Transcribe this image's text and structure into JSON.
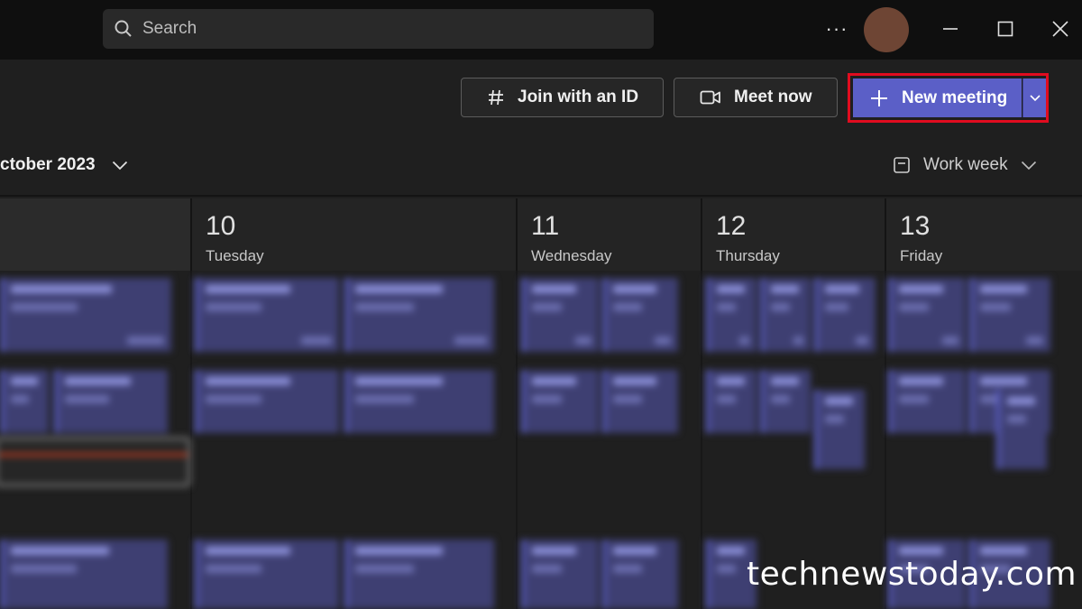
{
  "titlebar": {
    "search_placeholder": "Search",
    "more_label": "···",
    "avatar_color": "#6e4534"
  },
  "toolbar": {
    "join_label": "Join with an ID",
    "meet_label": "Meet now",
    "new_meeting_label": "New meeting",
    "highlight_color": "#e00c1f",
    "accent_color": "#5b5fc7"
  },
  "calendar": {
    "month_label": "ctober 2023",
    "view_label": "Work week",
    "days": [
      {
        "num": "10",
        "name": "Tuesday"
      },
      {
        "num": "11",
        "name": "Wednesday"
      },
      {
        "num": "12",
        "name": "Thursday"
      },
      {
        "num": "13",
        "name": "Friday"
      }
    ]
  },
  "watermark": "technewstoday.com"
}
